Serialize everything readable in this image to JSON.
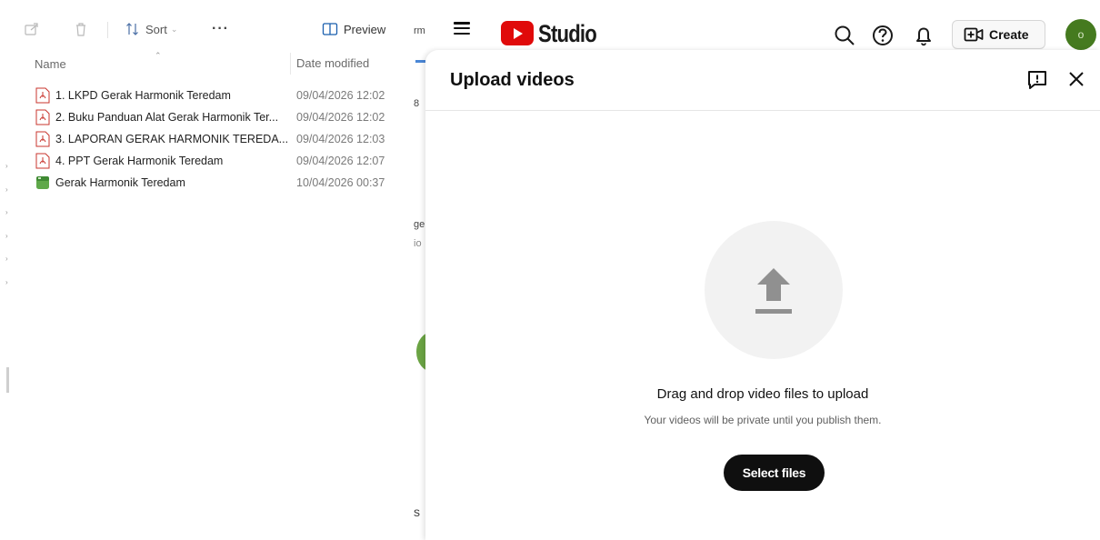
{
  "explorer": {
    "toolbar": {
      "share_icon": "share-icon",
      "delete_icon": "trash-icon",
      "sort_label": "Sort",
      "more_label": "···",
      "preview_label": "Preview"
    },
    "columns": {
      "name": "Name",
      "date_modified": "Date modified"
    },
    "files": [
      {
        "name": "1. LKPD Gerak Harmonik Teredam",
        "date": "09/04/2026 12:02",
        "type": "pdf"
      },
      {
        "name": "2. Buku Panduan Alat Gerak Harmonik Ter...",
        "date": "09/04/2026 12:02",
        "type": "pdf"
      },
      {
        "name": "3. LAPORAN GERAK HARMONIK TEREDA...",
        "date": "09/04/2026 12:03",
        "type": "pdf"
      },
      {
        "name": "4. PPT Gerak Harmonik Teredam",
        "date": "09/04/2026 12:07",
        "type": "pdf"
      },
      {
        "name": "Gerak Harmonik Teredam",
        "date": "10/04/2026 00:37",
        "type": "video"
      }
    ]
  },
  "background_strip": {
    "t1": "rm",
    "t2": "8",
    "t3": "ge",
    "t4": "io",
    "t5": "s"
  },
  "studio": {
    "brand": "Studio",
    "create_label": "Create",
    "avatar_initial": "o",
    "accent": "#e00a0a"
  },
  "dialog": {
    "title": "Upload videos",
    "drag_text": "Drag and drop video files to upload",
    "private_text": "Your videos will be private until you publish them.",
    "select_button": "Select files"
  }
}
